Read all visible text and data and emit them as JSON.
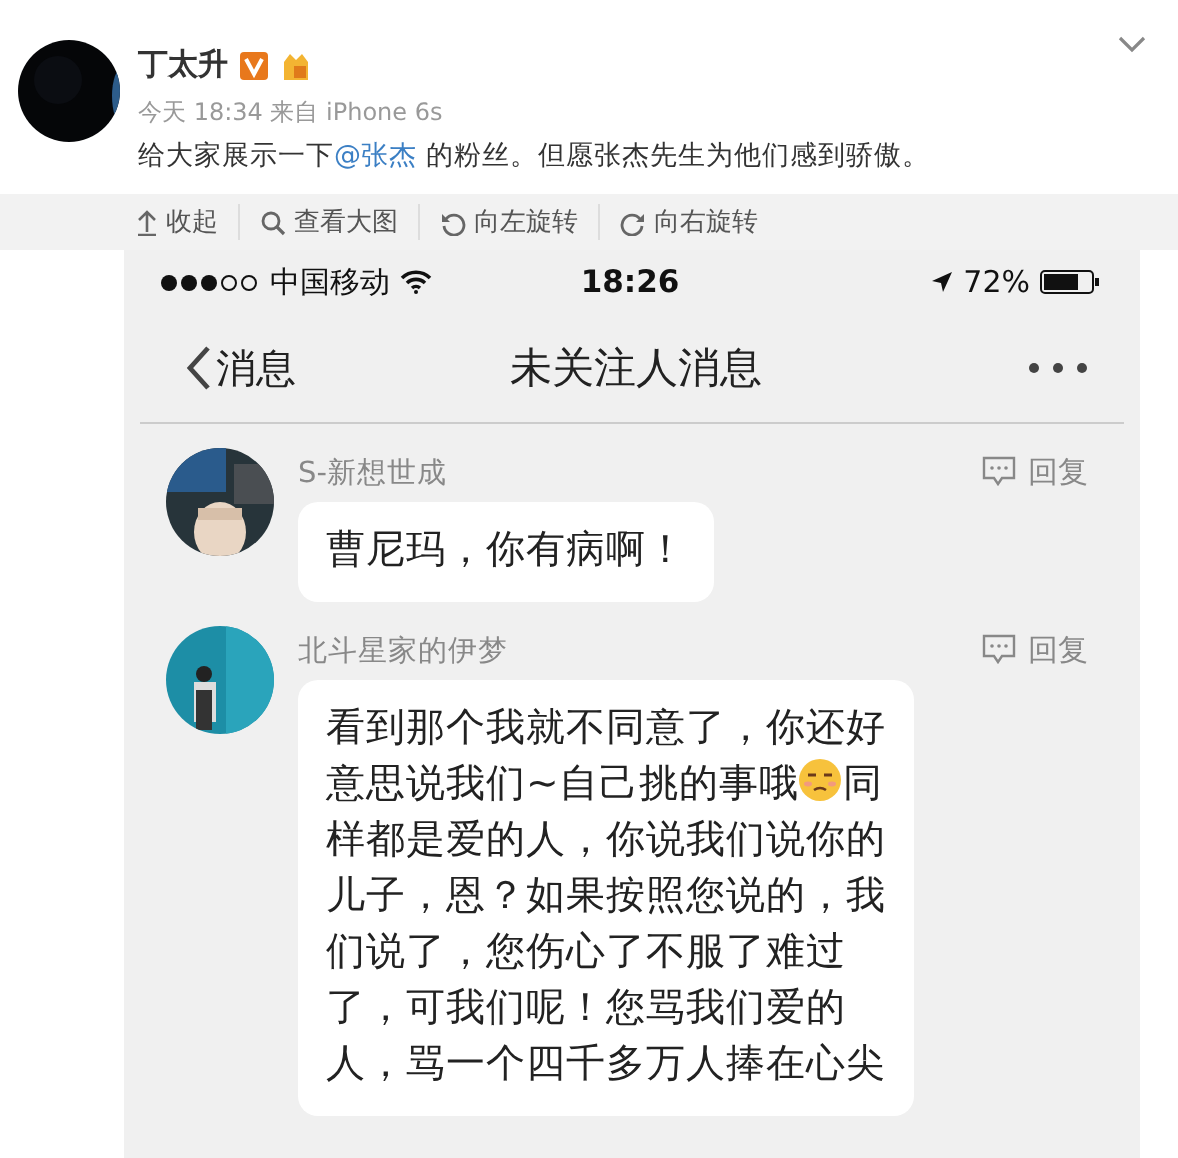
{
  "post": {
    "author": "丁太升",
    "meta": "今天 18:34 来自 iPhone 6s",
    "text_before": "给大家展示一下",
    "mention": "@张杰",
    "text_after": " 的粉丝。但愿张杰先生为他们感到骄傲。"
  },
  "toolbar": [
    {
      "kind": "collapse",
      "label": "收起"
    },
    {
      "kind": "zoom",
      "label": "查看大图"
    },
    {
      "kind": "rotate-left",
      "label": "向左旋转"
    },
    {
      "kind": "rotate-right",
      "label": "向右旋转"
    }
  ],
  "phone": {
    "status_bar": {
      "carrier": "中国移动",
      "time": "18:26",
      "battery": "72%"
    },
    "nav": {
      "back": "消息",
      "title": "未关注人消息"
    },
    "messages": [
      {
        "name": "S-新想世成",
        "reply": "回复",
        "lines": [
          [
            {
              "kind": "text",
              "text": "曹尼玛，你有病啊！"
            }
          ]
        ]
      },
      {
        "name": "北斗星家的伊梦",
        "reply": "回复",
        "lines": [
          [
            {
              "kind": "text",
              "text": "看到那个我就不同意了，你还好"
            }
          ],
          [
            {
              "kind": "text",
              "text": "意思说我们~自己挑的事哦"
            },
            {
              "kind": "emoji"
            },
            {
              "kind": "text",
              "text": "同"
            }
          ],
          [
            {
              "kind": "text",
              "text": "样都是爱的人，你说我们说你的"
            }
          ],
          [
            {
              "kind": "text",
              "text": "儿子，恩？如果按照您说的，我"
            }
          ],
          [
            {
              "kind": "text",
              "text": "们说了，您伤心了不服了难过"
            }
          ],
          [
            {
              "kind": "text",
              "text": "了，可我们呢！您骂我们爱的"
            }
          ],
          [
            {
              "kind": "text",
              "text": "人，骂一个四千多万人捧在心尖"
            }
          ]
        ]
      }
    ]
  }
}
